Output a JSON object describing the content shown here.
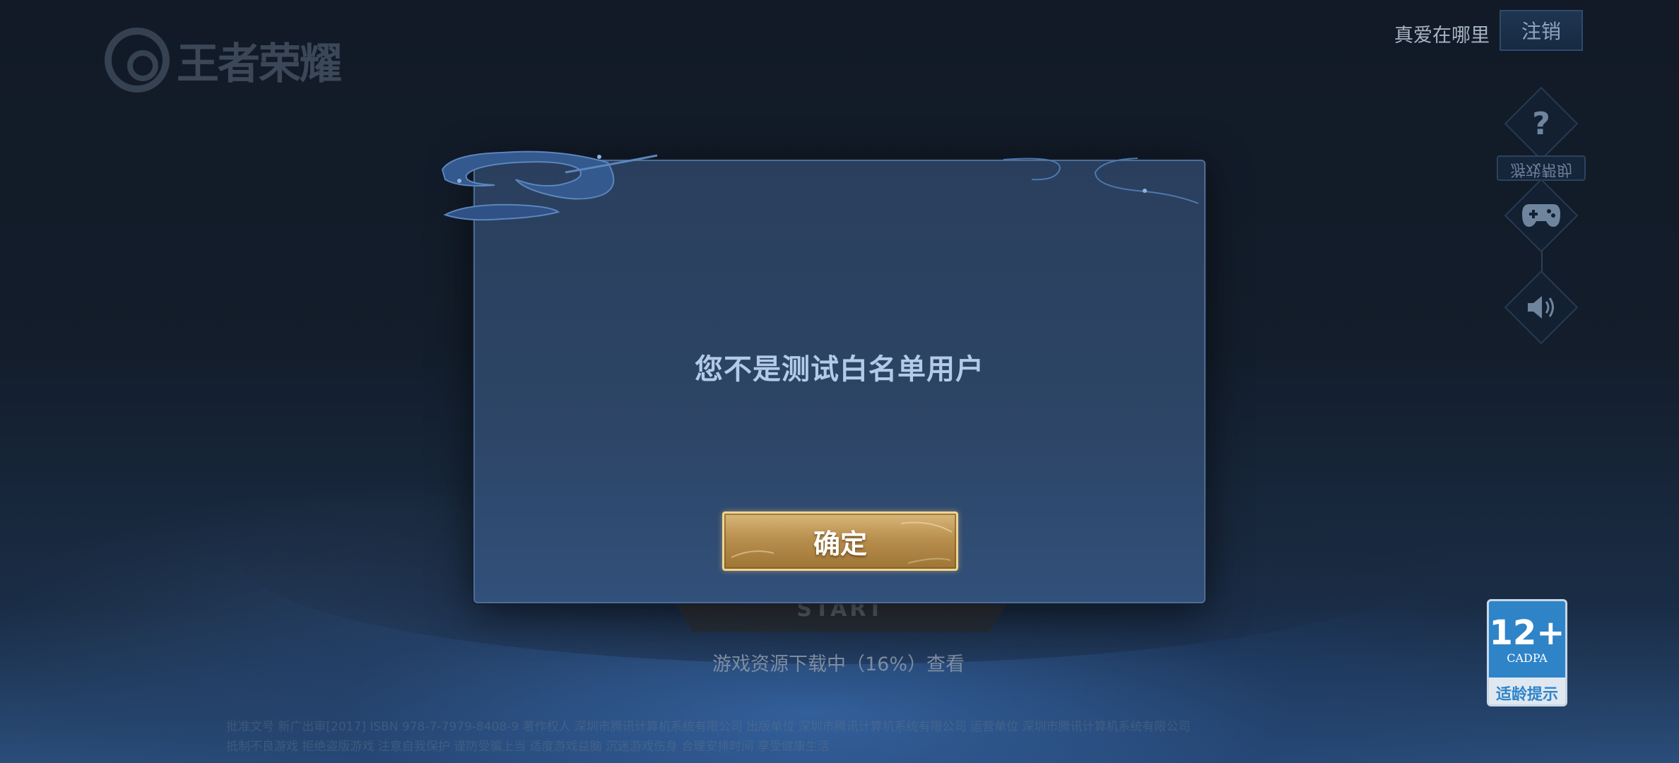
{
  "header": {
    "logo_text": "王者荣耀",
    "user_name": "真爱在哪里",
    "logout_label": "注销"
  },
  "side_menu": {
    "help_label": "游戏帮助",
    "items": [
      {
        "icon": "question-icon"
      },
      {
        "icon": "gamepad-icon"
      },
      {
        "icon": "speaker-icon"
      }
    ]
  },
  "main": {
    "start_label": "START",
    "download_status": "游戏资源下载中（16%）查看"
  },
  "footer": {
    "line1": "批准文号 新广出审[2017]  ISBN 978-7-7979-8408-9  著作权人 深圳市腾讯计算机系统有限公司  出版单位 深圳市腾讯计算机系统有限公司  运营单位 深圳市腾讯计算机系统有限公司",
    "line2": "抵制不良游戏 拒绝盗版游戏 注意自我保护 谨防受骗上当 适度游戏益脑 沉迷游戏伤身 合理安排时间 享受健康生活"
  },
  "age_rating": {
    "number": "12+",
    "org": "CADPA",
    "tip": "适龄提示"
  },
  "dialog": {
    "message": "您不是测试白名单用户",
    "confirm_label": "确定"
  },
  "colors": {
    "dialog_bg": "#2d4566",
    "dialog_border": "#4d6d96",
    "message_text": "#b3cbe8",
    "button_gold": "#c9a061",
    "age_blue": "#2f84c8"
  }
}
